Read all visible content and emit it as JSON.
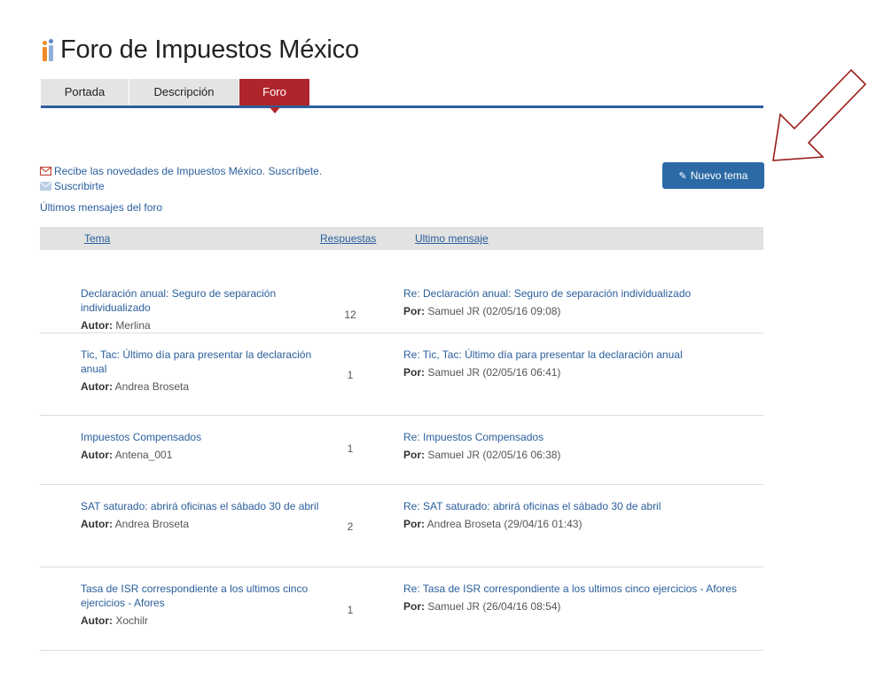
{
  "header": {
    "title": "Foro de Impuestos México",
    "logo_icon": "impuestos-logo"
  },
  "tabs": [
    {
      "label": "Portada",
      "active": false
    },
    {
      "label": "Descripción",
      "active": false
    },
    {
      "label": "Foro",
      "active": true
    }
  ],
  "subscribe": {
    "headline": "Recibe las novedades de Impuestos México. Suscríbete.",
    "link": "Suscribirte",
    "last_posts": "Últimos mensajes del foro"
  },
  "new_topic_button": "Nuevo tema",
  "table": {
    "headers": {
      "topic": "Tema",
      "replies": "Respuestas",
      "last": "Ultimo mensaje"
    },
    "author_label": "Autor:",
    "by_label": "Por:",
    "rows": [
      {
        "title": "Declaración anual: Seguro de separación individualizado",
        "author": "Merlina",
        "replies": "12",
        "last_title": "Re: Declaración anual: Seguro de separación individualizado",
        "last_by": "Samuel JR (02/05/16 09:08)"
      },
      {
        "title": "Tic, Tac: Último día para presentar la declaración anual",
        "author": "Andrea Broseta",
        "replies": "1",
        "last_title": "Re: Tic, Tac: Último día para presentar la declaración anual",
        "last_by": "Samuel JR (02/05/16 06:41)"
      },
      {
        "title": "Impuestos Compensados",
        "author": "Antena_001",
        "replies": "1",
        "last_title": "Re: Impuestos Compensados",
        "last_by": "Samuel JR (02/05/16 06:38)"
      },
      {
        "title": "SAT saturado: abrirá oficinas el sábado 30 de abril",
        "author": "Andrea Broseta",
        "replies": "2",
        "last_title": "Re: SAT saturado: abrirá oficinas el sábado 30 de abril",
        "last_by": "Andrea Broseta (29/04/16 01:43)"
      },
      {
        "title": "Tasa de ISR correspondiente a los ultimos cinco ejercicios - Afores",
        "author": "Xochilr",
        "replies": "1",
        "last_title": "Re: Tasa de ISR correspondiente a los ultimos cinco ejercicios - Afores",
        "last_by": "Samuel JR (26/04/16 08:54)"
      }
    ]
  },
  "colors": {
    "accent": "#2a5e9c",
    "active_tab": "#b0252c",
    "button": "#2c6aa6",
    "annotation_arrow": "#9b1c1c"
  }
}
